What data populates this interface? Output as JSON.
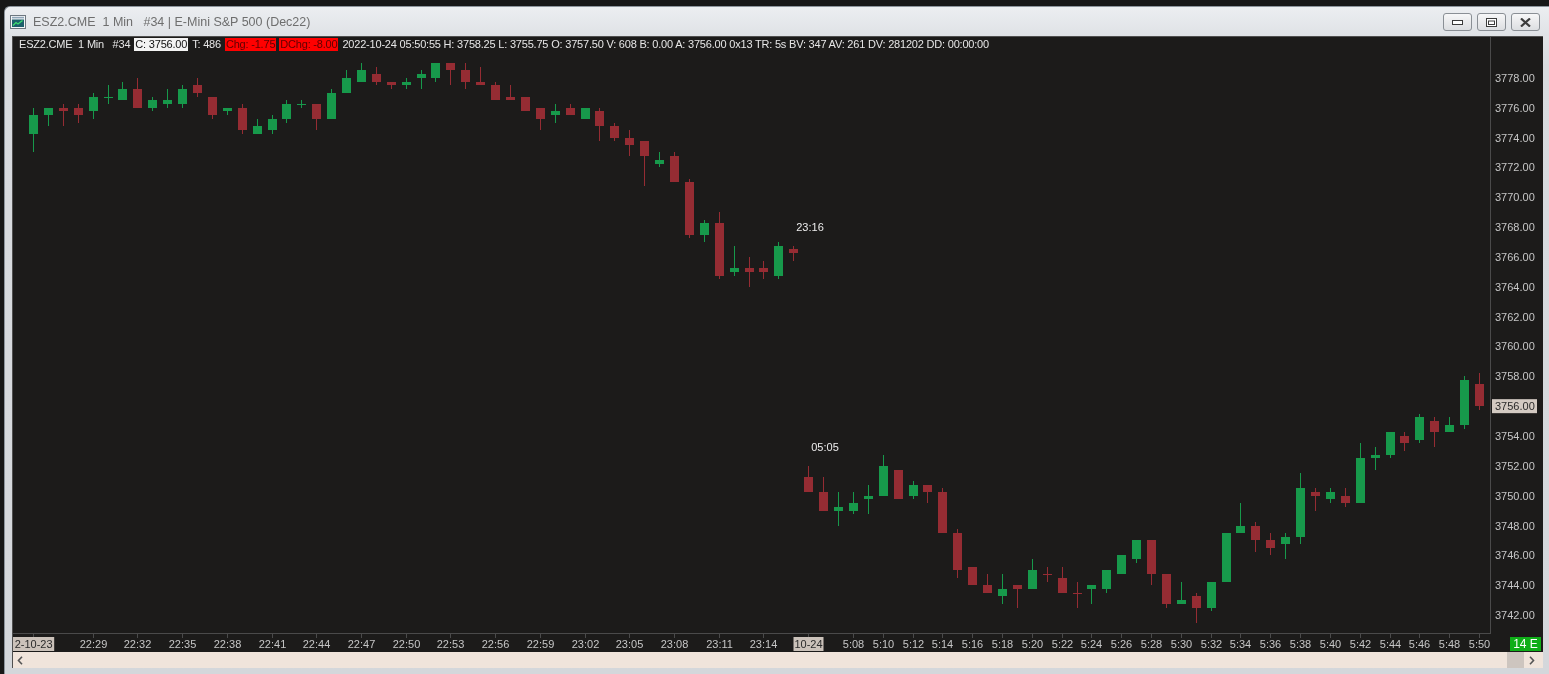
{
  "window": {
    "title": "ESZ2.CME  1 Min   #34 | E-Mini S&P 500 (Dec22)",
    "controls": [
      {
        "kind": "minimize"
      },
      {
        "kind": "restore"
      },
      {
        "kind": "close"
      }
    ]
  },
  "info_bar": {
    "items": [
      {
        "text": "ESZ2.CME  1 Min   #34",
        "kind": "plain"
      },
      {
        "text": "C: 3756.00",
        "kind": "price"
      },
      {
        "text": "T: 486",
        "kind": "plain"
      },
      {
        "text": "Chg: -1.75",
        "kind": "alert"
      },
      {
        "text": "DChg: -8.00",
        "kind": "alert"
      },
      {
        "text": "2022-10-24 05:50:55 H: 3758.25 L: 3755.75 O: 3757.50 V: 608 B: 0.00 A: 3756.00 0x13 TR: 5s BV: 347 AV: 261 DV: 281202 DD: 00:00:00",
        "kind": "plain"
      }
    ]
  },
  "chart": {
    "status_badge": "14 E",
    "time_labels": [
      {
        "highlighted": true
      },
      {
        "highlighted": false
      },
      {
        "highlighted": false
      },
      {
        "highlighted": false
      },
      {
        "highlighted": false
      },
      {
        "highlighted": false
      },
      {
        "highlighted": false
      },
      {
        "highlighted": false
      },
      {
        "highlighted": false
      },
      {
        "highlighted": false
      },
      {
        "highlighted": false
      },
      {
        "highlighted": false
      },
      {
        "highlighted": false
      },
      {
        "highlighted": false
      },
      {
        "highlighted": false
      },
      {
        "highlighted": false
      },
      {
        "highlighted": false
      },
      {
        "highlighted": true
      },
      {
        "highlighted": false
      },
      {
        "highlighted": false
      },
      {
        "highlighted": false
      },
      {
        "highlighted": false
      },
      {
        "highlighted": false
      },
      {
        "highlighted": false
      },
      {
        "highlighted": false
      },
      {
        "highlighted": false
      },
      {
        "highlighted": false
      },
      {
        "highlighted": false
      },
      {
        "highlighted": false
      },
      {
        "highlighted": false
      },
      {
        "highlighted": false
      },
      {
        "highlighted": false
      },
      {
        "highlighted": false
      },
      {
        "highlighted": false
      },
      {
        "highlighted": false
      },
      {
        "highlighted": false
      },
      {
        "highlighted": false
      },
      {
        "highlighted": false
      },
      {
        "highlighted": false
      },
      {
        "highlighted": false
      }
    ],
    "chart_data": {
      "type": "candlestick",
      "ylim": [
        3740.8,
        3779.8
      ],
      "yticks": [
        {
          "value": 3742,
          "label": "3742.00"
        },
        {
          "value": 3744,
          "label": "3744.00"
        },
        {
          "value": 3746,
          "label": "3746.00"
        },
        {
          "value": 3748,
          "label": "3748.00"
        },
        {
          "value": 3750,
          "label": "3750.00"
        },
        {
          "value": 3752,
          "label": "3752.00"
        },
        {
          "value": 3754,
          "label": "3754.00"
        },
        {
          "value": 3756,
          "label": "3756.00"
        },
        {
          "value": 3758,
          "label": "3758.00"
        },
        {
          "value": 3760,
          "label": "3760.00"
        },
        {
          "value": 3762,
          "label": "3762.00"
        },
        {
          "value": 3764,
          "label": "3764.00"
        },
        {
          "value": 3766,
          "label": "3766.00"
        },
        {
          "value": 3768,
          "label": "3768.00"
        },
        {
          "value": 3770,
          "label": "3770.00"
        },
        {
          "value": 3772,
          "label": "3772.00"
        },
        {
          "value": 3774,
          "label": "3774.00"
        },
        {
          "value": 3776,
          "label": "3776.00"
        },
        {
          "value": 3778,
          "label": "3778.00"
        }
      ],
      "categories": [
        "2-10-23",
        null,
        null,
        null,
        "22:29",
        null,
        null,
        "22:32",
        null,
        null,
        "22:35",
        null,
        null,
        "22:38",
        null,
        null,
        "22:41",
        null,
        null,
        "22:44",
        null,
        null,
        "22:47",
        null,
        null,
        "22:50",
        null,
        null,
        "22:53",
        null,
        null,
        "22:56",
        null,
        null,
        "22:59",
        null,
        null,
        "23:02",
        null,
        null,
        "23:05",
        null,
        null,
        "23:08",
        null,
        null,
        "23:11",
        null,
        null,
        "23:14",
        null,
        null,
        "10-24",
        null,
        null,
        "5:08",
        null,
        "5:10",
        null,
        "5:12",
        null,
        "5:14",
        null,
        "5:16",
        null,
        "5:18",
        null,
        "5:20",
        null,
        "5:22",
        null,
        "5:24",
        null,
        "5:26",
        null,
        "5:28",
        null,
        "5:30",
        null,
        "5:32",
        null,
        "5:34",
        null,
        "5:36",
        null,
        "5:38",
        null,
        "5:40",
        null,
        "5:42",
        null,
        "5:44",
        null,
        "5:46",
        null,
        "5:48",
        null,
        "5:50"
      ],
      "ohlc": [
        [
          3774.25,
          3776,
          3773,
          3775.5
        ],
        [
          3775.5,
          3776,
          3774.75,
          3776
        ],
        [
          3776,
          3776.25,
          3774.75,
          3775.75
        ],
        [
          3776,
          3776.25,
          3775,
          3775.5
        ],
        [
          3775.75,
          3777,
          3775.25,
          3776.75
        ],
        [
          3776.75,
          3777.5,
          3776.25,
          3776.75
        ],
        [
          3776.5,
          3777.75,
          3776.5,
          3777.25
        ],
        [
          3777.25,
          3778,
          3776,
          3776
        ],
        [
          3776,
          3776.75,
          3775.75,
          3776.5
        ],
        [
          3776.25,
          3777.25,
          3776,
          3776.5
        ],
        [
          3776.25,
          3777.5,
          3776,
          3777.25
        ],
        [
          3777.5,
          3778,
          3776.75,
          3777
        ],
        [
          3776.75,
          3776.75,
          3775.25,
          3775.5
        ],
        [
          3775.75,
          3776,
          3775.5,
          3776
        ],
        [
          3776,
          3776.25,
          3774.25,
          3774.5
        ],
        [
          3774.25,
          3775.25,
          3774.25,
          3774.75
        ],
        [
          3774.5,
          3775.5,
          3774.25,
          3775.25
        ],
        [
          3775.25,
          3776.5,
          3775,
          3776.25
        ],
        [
          3776.25,
          3776.5,
          3776,
          3776.25
        ],
        [
          3776.25,
          3776.25,
          3774.5,
          3775.25
        ],
        [
          3775.25,
          3777.25,
          3775.25,
          3777
        ],
        [
          3777,
          3778.5,
          3777,
          3778
        ],
        [
          3777.75,
          3779,
          3777.75,
          3778.5
        ],
        [
          3778.25,
          3778.75,
          3777.5,
          3777.75
        ],
        [
          3777.75,
          3777.75,
          3777.25,
          3777.5
        ],
        [
          3777.5,
          3778,
          3777.25,
          3777.75
        ],
        [
          3778,
          3778.5,
          3777.25,
          3778.25
        ],
        [
          3778,
          3779,
          3777.75,
          3779
        ],
        [
          3779,
          3779,
          3777.5,
          3778.5
        ],
        [
          3778.5,
          3779,
          3777.25,
          3777.75
        ],
        [
          3777.75,
          3778.75,
          3777.5,
          3777.5
        ],
        [
          3777.5,
          3777.75,
          3776.5,
          3776.5
        ],
        [
          3776.75,
          3777.5,
          3776.5,
          3776.5
        ],
        [
          3776.75,
          3776.75,
          3775.75,
          3775.75
        ],
        [
          3776,
          3776,
          3774.5,
          3775.25
        ],
        [
          3775.5,
          3776.25,
          3775,
          3775.75
        ],
        [
          3776,
          3776.25,
          3775.5,
          3775.5
        ],
        [
          3775.25,
          3776,
          3775.25,
          3776
        ],
        [
          3775.75,
          3776,
          3773.75,
          3774.75
        ],
        [
          3774.75,
          3775,
          3773.75,
          3774
        ],
        [
          3774,
          3774.5,
          3772.75,
          3773.5
        ],
        [
          3773.75,
          3773.75,
          3770.75,
          3772.75
        ],
        [
          3772.25,
          3773,
          3772,
          3772.5
        ],
        [
          3772.75,
          3773,
          3771,
          3771
        ],
        [
          3771,
          3771.25,
          3767.25,
          3767.5
        ],
        [
          3767.5,
          3768.5,
          3767,
          3768.25
        ],
        [
          3768.25,
          3769,
          3764.5,
          3764.75
        ],
        [
          3765,
          3766.75,
          3764.75,
          3765.25
        ],
        [
          3765.25,
          3766,
          3764,
          3765
        ],
        [
          3765.25,
          3765.75,
          3764.5,
          3765
        ],
        [
          3764.75,
          3767,
          3764.5,
          3766.75
        ],
        [
          3766.5,
          3766.75,
          3765.75,
          3766.25
        ],
        [
          3751.25,
          3752,
          3750.25,
          3750.25
        ],
        [
          3750.25,
          3751.25,
          3749,
          3749
        ],
        [
          3749,
          3750.25,
          3748,
          3749.25
        ],
        [
          3749,
          3750.25,
          3748.75,
          3749.5
        ],
        [
          3749.75,
          3750.75,
          3748.75,
          3750
        ],
        [
          3750,
          3752.75,
          3750,
          3752
        ],
        [
          3751.75,
          3751.75,
          3749.75,
          3749.75
        ],
        [
          3750,
          3751,
          3749.75,
          3750.75
        ],
        [
          3750.75,
          3750.75,
          3749.5,
          3750.25
        ],
        [
          3750.25,
          3750.5,
          3747.5,
          3747.5
        ],
        [
          3747.5,
          3747.75,
          3744.5,
          3745
        ],
        [
          3745.25,
          3745.25,
          3744,
          3744
        ],
        [
          3744,
          3744.75,
          3743.5,
          3743.5
        ],
        [
          3743.25,
          3744.75,
          3742.75,
          3743.75
        ],
        [
          3744,
          3744,
          3742.5,
          3743.75
        ],
        [
          3743.75,
          3745.75,
          3743.75,
          3745
        ],
        [
          3744.75,
          3745.25,
          3744.25,
          3744.75
        ],
        [
          3744.5,
          3745.25,
          3743.5,
          3743.5
        ],
        [
          3743.5,
          3744.25,
          3742.5,
          3743.5
        ],
        [
          3743.75,
          3744,
          3742.75,
          3744
        ],
        [
          3743.75,
          3745,
          3743.5,
          3745
        ],
        [
          3744.75,
          3746,
          3744.75,
          3746
        ],
        [
          3745.75,
          3747,
          3745.5,
          3747
        ],
        [
          3747,
          3747,
          3744,
          3744.75
        ],
        [
          3744.75,
          3744.75,
          3742.5,
          3742.75
        ],
        [
          3742.75,
          3744.25,
          3742.75,
          3743
        ],
        [
          3743.25,
          3743.5,
          3741.5,
          3742.5
        ],
        [
          3742.5,
          3744.25,
          3742.25,
          3744.25
        ],
        [
          3744.25,
          3747.5,
          3744.25,
          3747.5
        ],
        [
          3747.5,
          3749.5,
          3747.5,
          3748
        ],
        [
          3748,
          3748.25,
          3746.25,
          3747
        ],
        [
          3747,
          3747.5,
          3746,
          3746.5
        ],
        [
          3746.75,
          3747.5,
          3745.75,
          3747.25
        ],
        [
          3747.25,
          3751.5,
          3746.75,
          3750.5
        ],
        [
          3750.25,
          3750.5,
          3749,
          3750
        ],
        [
          3749.75,
          3750.5,
          3749.5,
          3750.25
        ],
        [
          3750,
          3750.5,
          3749.25,
          3749.5
        ],
        [
          3749.5,
          3753.5,
          3749.5,
          3752.5
        ],
        [
          3752.5,
          3753.25,
          3751.75,
          3752.75
        ],
        [
          3752.75,
          3754.25,
          3752.5,
          3754.25
        ],
        [
          3754,
          3754.25,
          3753,
          3753.5
        ],
        [
          3753.75,
          3755.5,
          3753.5,
          3755.25
        ],
        [
          3755,
          3755.25,
          3753.25,
          3754.25
        ],
        [
          3754.25,
          3755.25,
          3754.25,
          3754.75
        ],
        [
          3754.75,
          3758,
          3754.5,
          3757.75
        ],
        [
          3757.5,
          3758.25,
          3755.75,
          3756
        ]
      ],
      "annotations": [
        "23:16",
        "05:05"
      ]
    }
  }
}
